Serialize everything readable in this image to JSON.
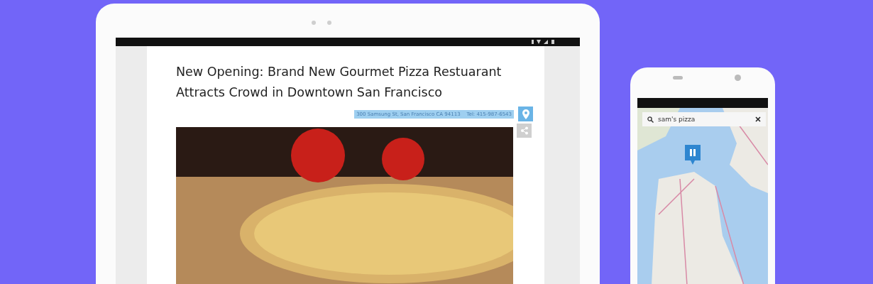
{
  "tablet": {
    "article": {
      "title": "New Opening: Brand New Gourmet Pizza Restuarant Attracts Crowd in Downtown San Francisco",
      "address": "300 Samsung St, San Francisco CA 94113    Tel: 415-987-6543"
    }
  },
  "phone": {
    "search": {
      "value": "sam's pizza"
    }
  }
}
